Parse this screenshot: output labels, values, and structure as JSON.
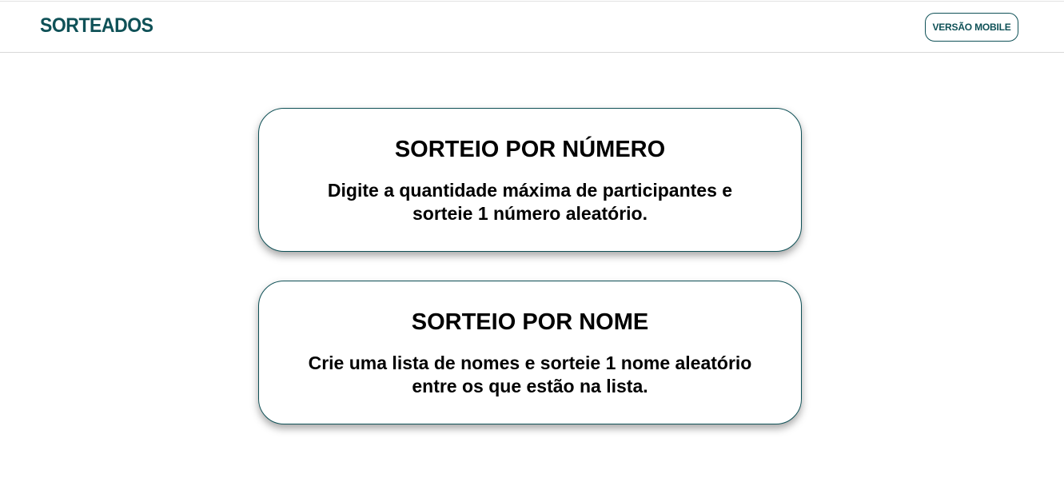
{
  "header": {
    "logo": "SORTEADOS",
    "mobile_button": "VERSÃO MOBILE"
  },
  "cards": [
    {
      "title": "SORTEIO POR NÚMERO",
      "desc_line1": "Digite a quantidade máxima de participantes e",
      "desc_line2": "sorteie 1 número aleatório."
    },
    {
      "title": "SORTEIO POR NOME",
      "desc_line1": "Crie uma lista de nomes e sorteie 1 nome aleatório",
      "desc_line2": "entre os que estão na lista."
    }
  ],
  "colors": {
    "brand": "#0f5157",
    "text": "#000000",
    "background": "#ffffff"
  }
}
